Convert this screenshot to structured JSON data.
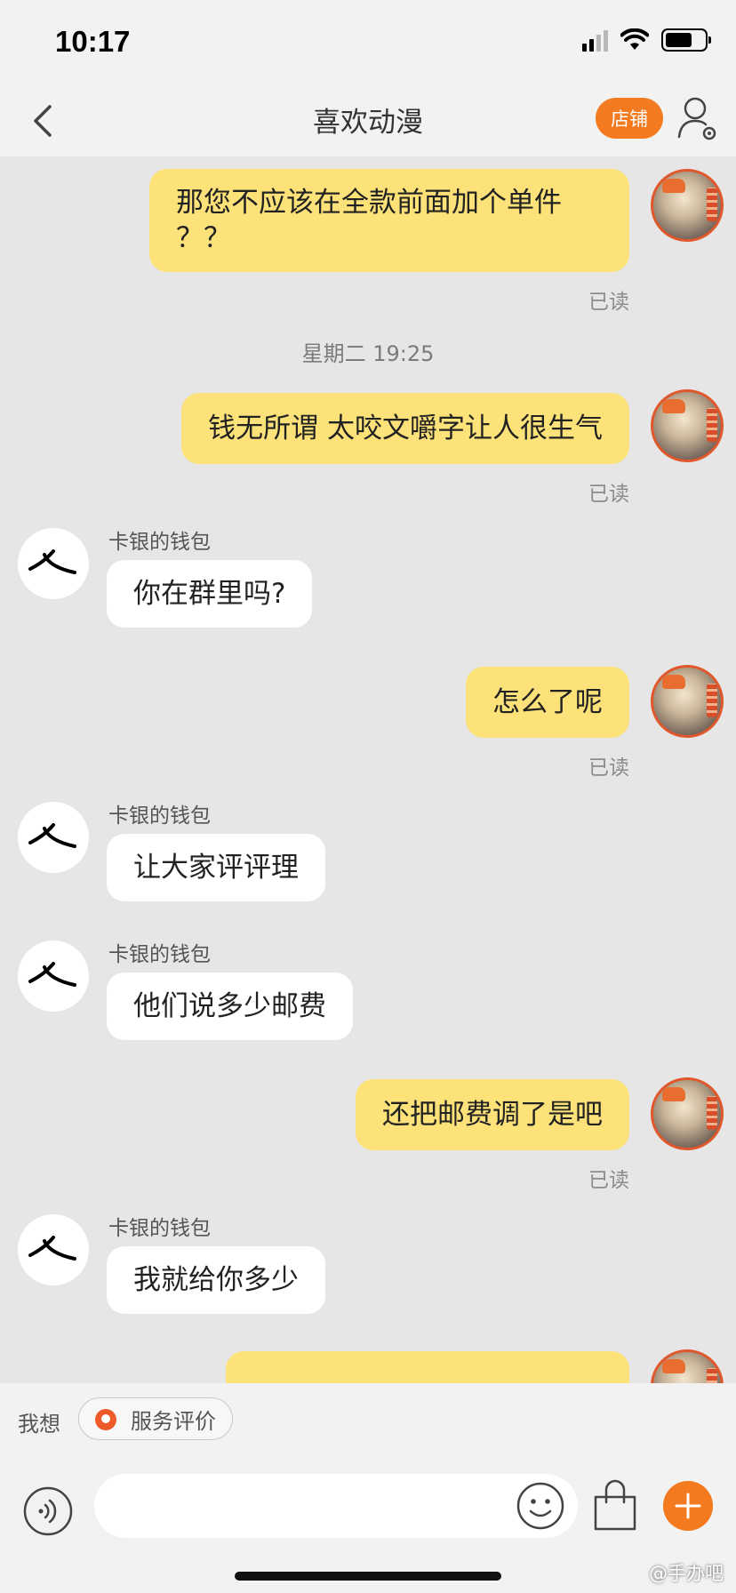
{
  "status_bar": {
    "time": "10:17"
  },
  "nav": {
    "title": "喜欢动漫",
    "shop_label": "店铺"
  },
  "messages": [
    {
      "text_line1": "那您不应该在全款前面加个单件",
      "text_line2": "？？",
      "read": "已读"
    },
    {
      "timestamp": "星期二 19:25"
    },
    {
      "text": "钱无所谓 太咬文嚼字让人很生气",
      "read": "已读"
    },
    {
      "sender": "卡银的钱包",
      "text": "你在群里吗?"
    },
    {
      "text": "怎么了呢",
      "read": "已读"
    },
    {
      "sender": "卡银的钱包",
      "text": "让大家评评理"
    },
    {
      "sender": "卡银的钱包",
      "text": "他们说多少邮费"
    },
    {
      "text": "还把邮费调了是吧",
      "read": "已读"
    },
    {
      "sender": "卡银的钱包",
      "text": "我就给你多少"
    }
  ],
  "quick_bar": {
    "label": "我想",
    "chip": "服务评价"
  },
  "input": {
    "placeholder": ""
  },
  "watermark": "@手办吧",
  "colors": {
    "accent": "#f47a20",
    "my_bubble": "#fce278",
    "background": "#e6e6e6"
  }
}
